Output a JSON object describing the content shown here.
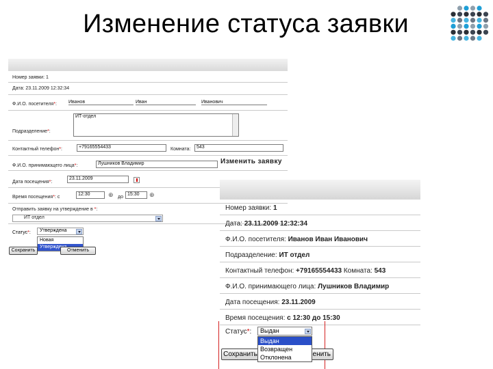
{
  "slide_title": "Изменение статуса заявки",
  "left_form": {
    "request_number": "Номер заявки: 1",
    "date": "Дата: 23.11.2009 12:32:34",
    "visitor_label": "Ф.И.О. посетителя",
    "visitor_last": "Иванов",
    "visitor_first": "Иван",
    "visitor_middle": "Иванович",
    "department_label": "Подразделение",
    "department_value": "ИТ-отдел",
    "phone_label": "Контактный телефон",
    "phone_value": "+79165554433",
    "room_label": "Комната",
    "room_value": "543",
    "host_label": "Ф.И.О. принимающего лица",
    "host_value": "Лушников Владимир",
    "visit_date_label": "Дата посещения",
    "visit_date_value": "23.11.2009",
    "visit_time_label": "Время посещения",
    "time_from_prefix": "с",
    "time_from": "12:30",
    "time_to_prefix": "до",
    "time_to": "15:30",
    "approval_label": "Отправить заявку на утверждение в",
    "approval_value": "ИТ отдел",
    "status_label": "Статус",
    "status_selected": "Утверждена",
    "status_options": [
      "Новая",
      "Утверждена"
    ],
    "save_button": "Сохранить",
    "cancel_button": "Отменить",
    "req_mark": "*",
    "colon": ":"
  },
  "right_panel": {
    "title": "Изменить заявку",
    "rows": [
      {
        "label": "Номер заявки: ",
        "value": "1"
      },
      {
        "label": "Дата: ",
        "value": "23.11.2009 12:32:34"
      },
      {
        "label": "Ф.И.О. посетителя: ",
        "value": "Иванов Иван Иванович"
      },
      {
        "label": "Подразделение: ",
        "value": "ИТ отдел"
      },
      {
        "label": "Контактный телефон: ",
        "value": "+79165554433",
        "label2": " Комната: ",
        "value2": "543"
      },
      {
        "label": "Ф.И.О. принимающего лица: ",
        "value": "Лушников Владимир"
      },
      {
        "label": "Дата посещения: ",
        "value": "23.11.2009"
      },
      {
        "label": "Время посещения: ",
        "value": "с 12:30 до 15:30"
      }
    ],
    "status_label": "Статус",
    "status_selected": "Выдан",
    "status_options": [
      "Выдан",
      "Возвращен",
      "Отклонена"
    ],
    "save_button": "Сохранить",
    "cancel_button": "Отменить"
  },
  "colors": {
    "required": "#d00000",
    "highlight": "#2a4fc8",
    "annotation_line": "#d42020"
  }
}
